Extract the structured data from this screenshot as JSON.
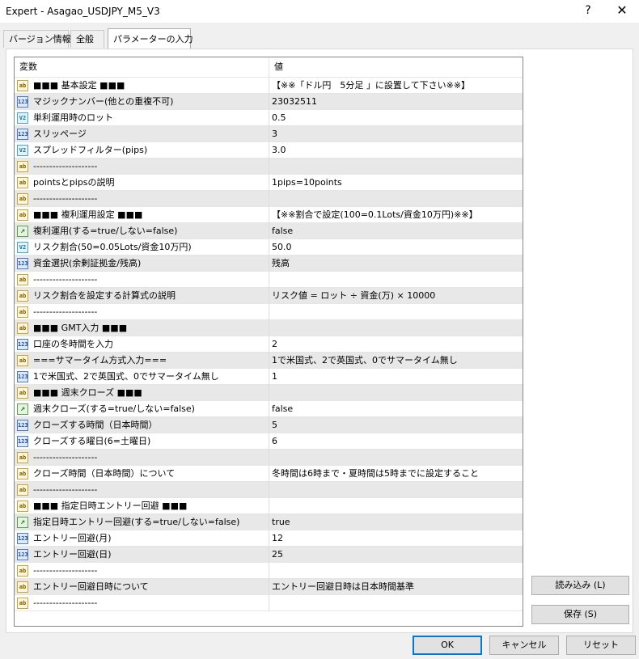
{
  "window": {
    "title": "Expert - Asagao_USDJPY_M5_V3",
    "help": "?",
    "close": "✕"
  },
  "tabs": [
    {
      "label": "バージョン情報"
    },
    {
      "label": "全般"
    },
    {
      "label": "パラメーターの入力"
    }
  ],
  "grid": {
    "headers": {
      "variable": "変数",
      "value": "値"
    },
    "rows": [
      {
        "type": "ab",
        "variable": "■■■ 基本設定 ■■■",
        "value": "【※※「ドル円　5分足 」に設置して下さい※※】"
      },
      {
        "type": "123",
        "variable": "マジックナンバー(他との重複不可)",
        "value": "23032511"
      },
      {
        "type": "v2",
        "variable": "単利運用時のロット",
        "value": "0.5"
      },
      {
        "type": "123",
        "variable": "スリッページ",
        "value": "3"
      },
      {
        "type": "v2",
        "variable": "スプレッドフィルター(pips)",
        "value": "3.0"
      },
      {
        "type": "ab",
        "variable": "--------------------",
        "value": ""
      },
      {
        "type": "ab",
        "variable": "pointsとpipsの説明",
        "value": "1pips=10points"
      },
      {
        "type": "ab",
        "variable": "--------------------",
        "value": ""
      },
      {
        "type": "ab",
        "variable": "■■■ 複利運用設定 ■■■",
        "value": "【※※割合で設定(100=0.1Lots/資金10万円)※※】"
      },
      {
        "type": "bool",
        "variable": "複利運用(する=true/しない=false)",
        "value": "false"
      },
      {
        "type": "v2",
        "variable": "リスク割合(50=0.05Lots/資金10万円)",
        "value": "50.0"
      },
      {
        "type": "123",
        "variable": "資金選択(余剰証拠金/残高)",
        "value": "残高"
      },
      {
        "type": "ab",
        "variable": "--------------------",
        "value": ""
      },
      {
        "type": "ab",
        "variable": "リスク割合を設定する計算式の説明",
        "value": "リスク値 = ロット ÷ 資金(万) × 10000"
      },
      {
        "type": "ab",
        "variable": "--------------------",
        "value": ""
      },
      {
        "type": "ab",
        "variable": "■■■ GMT入力 ■■■",
        "value": ""
      },
      {
        "type": "123",
        "variable": "口座の冬時間を入力",
        "value": "2"
      },
      {
        "type": "ab",
        "variable": "===サマータイム方式入力===",
        "value": "1で米国式、2で英国式、0でサマータイム無し"
      },
      {
        "type": "123",
        "variable": "1で米国式、2で英国式、0でサマータイム無し",
        "value": "1"
      },
      {
        "type": "ab",
        "variable": "■■■ 週末クローズ ■■■",
        "value": ""
      },
      {
        "type": "bool",
        "variable": "週末クローズ(する=true/しない=false)",
        "value": "false"
      },
      {
        "type": "123",
        "variable": "クローズする時間（日本時間）",
        "value": "5"
      },
      {
        "type": "123",
        "variable": "クローズする曜日(6=土曜日)",
        "value": "6"
      },
      {
        "type": "ab",
        "variable": "--------------------",
        "value": ""
      },
      {
        "type": "ab",
        "variable": "クローズ時間（日本時間）について",
        "value": "冬時間は6時まで・夏時間は5時までに設定すること"
      },
      {
        "type": "ab",
        "variable": "--------------------",
        "value": ""
      },
      {
        "type": "ab",
        "variable": "■■■ 指定日時エントリー回避 ■■■",
        "value": ""
      },
      {
        "type": "bool",
        "variable": "指定日時エントリー回避(する=true/しない=false)",
        "value": "true"
      },
      {
        "type": "123",
        "variable": "エントリー回避(月)",
        "value": "12"
      },
      {
        "type": "123",
        "variable": "エントリー回避(日)",
        "value": "25"
      },
      {
        "type": "ab",
        "variable": "--------------------",
        "value": ""
      },
      {
        "type": "ab",
        "variable": "エントリー回避日時について",
        "value": "エントリー回避日時は日本時間基準"
      },
      {
        "type": "ab",
        "variable": "--------------------",
        "value": ""
      }
    ]
  },
  "icons": {
    "ab": "ab",
    "123": "123",
    "v2": "V2",
    "bool": "↗"
  },
  "side_buttons": {
    "load": "読み込み (L)",
    "save": "保存 (S)"
  },
  "footer": {
    "ok": "OK",
    "cancel": "キャンセル",
    "reset": "リセット"
  }
}
